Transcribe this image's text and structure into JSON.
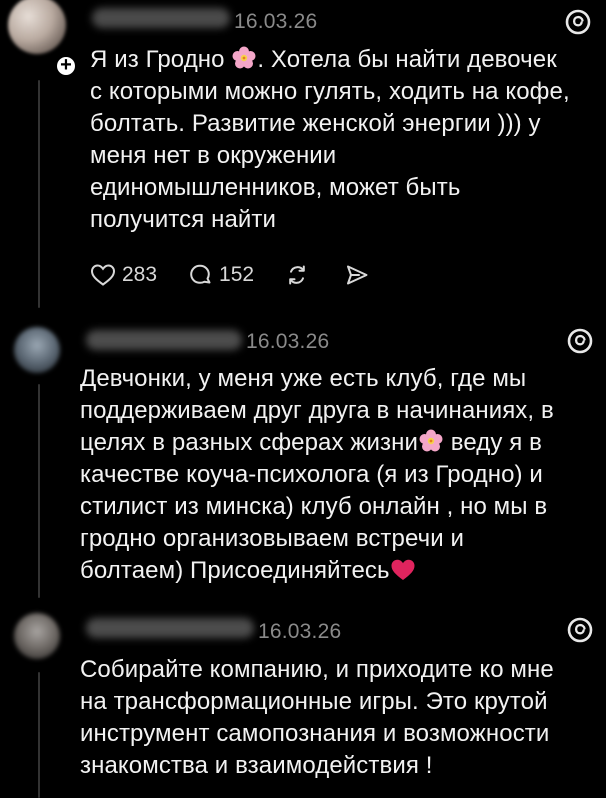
{
  "posts": [
    {
      "timestamp": "16.03.26",
      "text_before_flower": "Я из Гродно ",
      "text_after_flower": ". Хотела бы найти девочек\nс которыми можно гулять, ходить на кофе,\nболтать. Развитие женской энергии ))) у\nменя нет в окружении\nединомышленников, может быть\nполучится найти",
      "likes": "283",
      "comments": "152"
    },
    {
      "timestamp": "16.03.26",
      "text_before_flower": "Девчонки, у меня уже есть клуб, где мы\nподдерживаем друг друга в начинаниях, в\nцелях в разных сферах жизни",
      "text_after_flower": " веду я в\nкачестве коуча-психолога (я из Гродно) и\nстилист из минска) клуб онлайн , но мы в\nгродно организовываем встречи и\nболтаем)  Присоединяйтесь"
    },
    {
      "timestamp": "16.03.26",
      "text": "Собирайте компанию, и приходите ко мне\nна трансформационные игры. Это крутой\nинструмент самопознания и возможности\nзнакомства и взаимодействия !"
    }
  ],
  "icons": {
    "flower": "cherry-blossom-icon",
    "heart_emoji": "red-heart-icon",
    "threads_logo": "threads-logo-icon",
    "like": "heart-outline-icon",
    "comment": "comment-bubble-icon",
    "repost": "repost-icon",
    "share": "send-icon",
    "follow": "plus-icon"
  },
  "colors": {
    "background": "#000000",
    "text": "#f2f2f2",
    "timestamp": "#8a8a8a",
    "thread_line": "#333333",
    "heart_emoji": "#e0245e",
    "flower": "#f4a6c8"
  }
}
